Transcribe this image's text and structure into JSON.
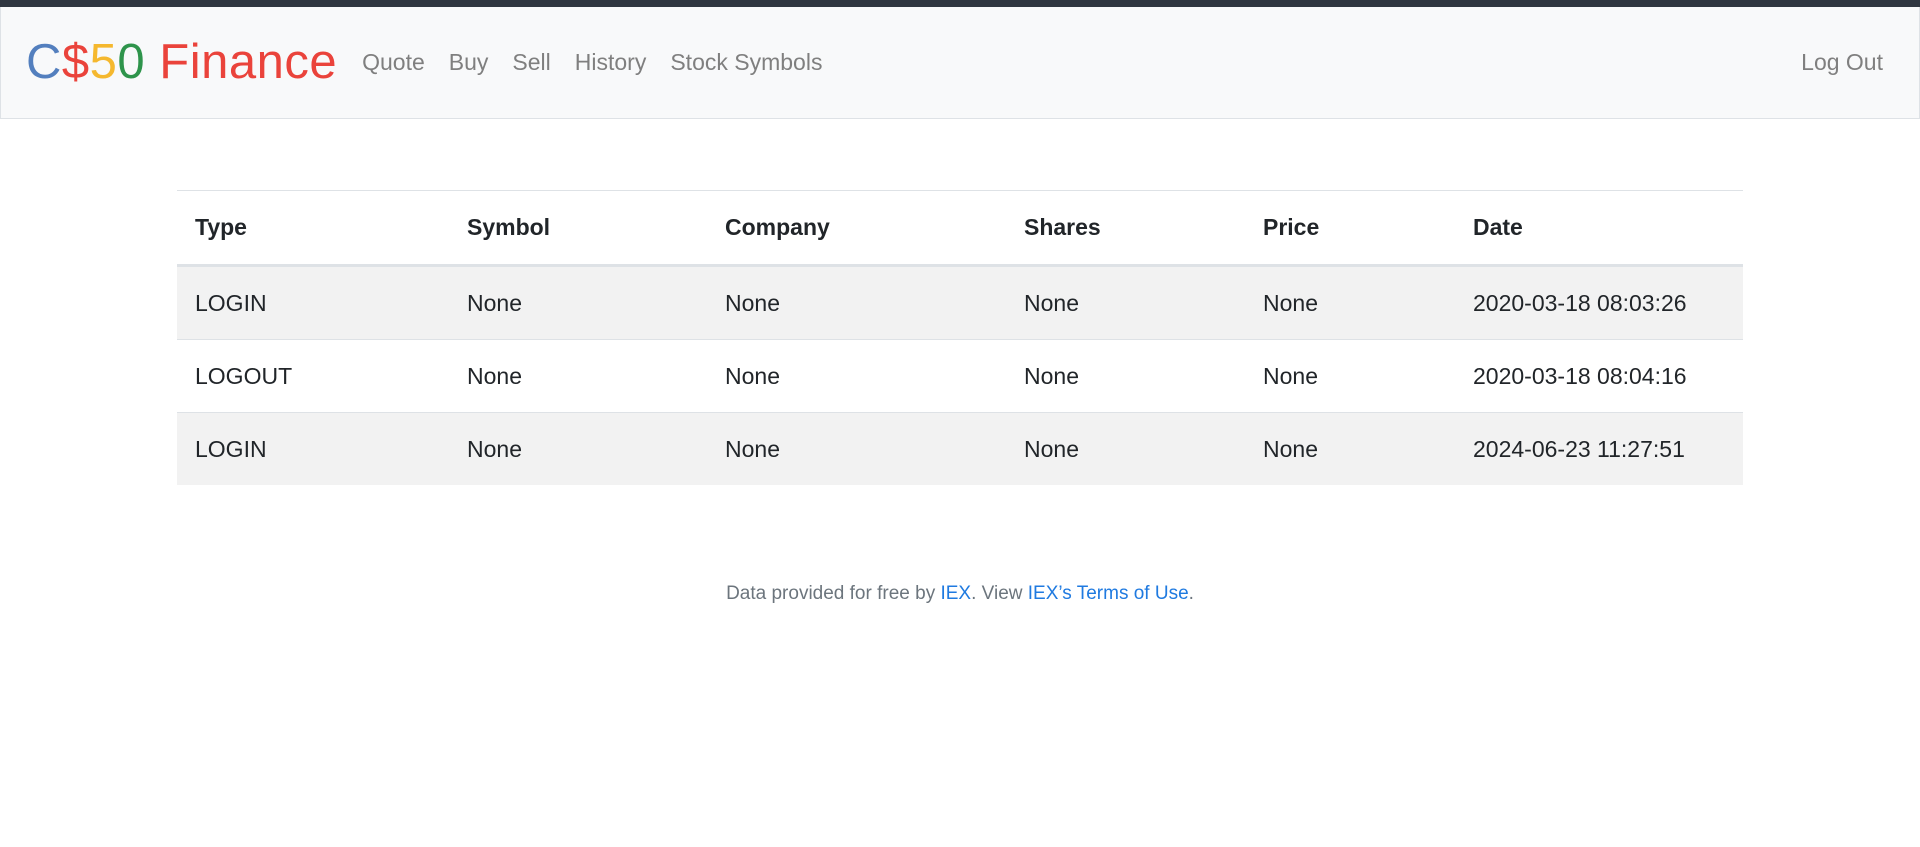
{
  "brand": {
    "parts": [
      {
        "text": "C",
        "color": "#537fbe"
      },
      {
        "text": "$",
        "color": "#ea433b"
      },
      {
        "text": "5",
        "color": "#f5b82e"
      },
      {
        "text": "0",
        "color": "#2e944b"
      },
      {
        "text": " Finance",
        "color": "#ea433b"
      }
    ]
  },
  "nav": {
    "items": [
      {
        "label": "Quote"
      },
      {
        "label": "Buy"
      },
      {
        "label": "Sell"
      },
      {
        "label": "History"
      },
      {
        "label": "Stock Symbols"
      }
    ],
    "logout_label": "Log Out"
  },
  "table": {
    "headers": [
      "Type",
      "Symbol",
      "Company",
      "Shares",
      "Price",
      "Date"
    ],
    "rows": [
      [
        "LOGIN",
        "None",
        "None",
        "None",
        "None",
        "2020-03-18 08:03:26"
      ],
      [
        "LOGOUT",
        "None",
        "None",
        "None",
        "None",
        "2020-03-18 08:04:16"
      ],
      [
        "LOGIN",
        "None",
        "None",
        "None",
        "None",
        "2024-06-23 11:27:51"
      ]
    ]
  },
  "footer": {
    "prefix": "Data provided for free by ",
    "iex_link": "IEX",
    "middle": ". View ",
    "terms_link": "IEX’s Terms of Use",
    "suffix": "."
  }
}
